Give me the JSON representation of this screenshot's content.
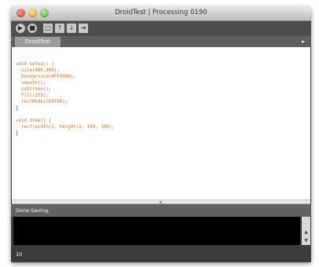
{
  "window": {
    "title": "DroidTest | Processing 0190"
  },
  "toolbar": {
    "buttons": [
      {
        "name": "run-button",
        "glyph": "▶"
      },
      {
        "name": "stop-button",
        "glyph": "■"
      },
      {
        "name": "new-button",
        "glyph": "□"
      },
      {
        "name": "open-button",
        "glyph": "↑"
      },
      {
        "name": "save-button",
        "glyph": "↓"
      },
      {
        "name": "export-button",
        "glyph": "⇥"
      }
    ]
  },
  "tabs": [
    {
      "label": "DroidTest"
    }
  ],
  "tab_menu_glyph": "▸",
  "code": [
    {
      "text": "void setup() {",
      "color": "#d46a1f"
    },
    {
      "text": "  size(480,800);",
      "color": "#d46a1f"
    },
    {
      "text": "  background(#FF0000);",
      "color": "#d46a1f"
    },
    {
      "text": "  smooth();",
      "color": "#d46a1f"
    },
    {
      "text": "  noStroke();",
      "color": "#d46a1f"
    },
    {
      "text": "  fill(255);",
      "color": "#d46a1f"
    },
    {
      "text": "  rectMode(CENTER);",
      "color": "#d46a1f"
    },
    {
      "text": "}",
      "color": "#333333"
    },
    {
      "text": "",
      "color": "#333333"
    },
    {
      "text": "void draw() {",
      "color": "#d46a1f"
    },
    {
      "text": "  rect(width/2, height/2, 100, 100);",
      "color": "#d46a1f"
    },
    {
      "text": "}",
      "color": "#333333"
    }
  ],
  "status": {
    "message": "Done Saving."
  },
  "line_number": "10"
}
